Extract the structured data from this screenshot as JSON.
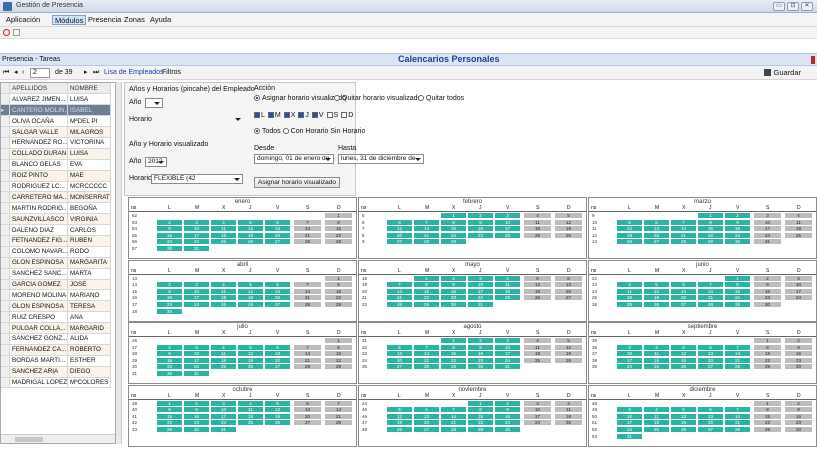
{
  "window": {
    "title": "Gestión de Presencia"
  },
  "menu": {
    "items": [
      "Aplicación",
      "Módulos",
      "Presencia",
      "Zonas",
      "Ayuda"
    ]
  },
  "panel": {
    "left_title": "Presencia - Tareas",
    "center_title": "Calencarios Personales"
  },
  "nav": {
    "position": "2",
    "of_text": "de 39",
    "list_link": "Lisa de Empleados",
    "filters": "Filtros",
    "save": "Guardar"
  },
  "grid": {
    "headers": [
      "APELLIDOS",
      "NOMBRE"
    ],
    "rows": [
      [
        "ALVAREZ JIMEN...",
        "LUISA"
      ],
      [
        "CANTERO MOLIN...",
        "ISABEL"
      ],
      [
        "OLIVA OCAÑA",
        "MªDEL PI"
      ],
      [
        "SALGAR VALLE",
        "MILAGROS"
      ],
      [
        "HERNANDEZ RO...",
        "VICTORINA"
      ],
      [
        "COLLADO DURAN",
        "LUISA"
      ],
      [
        "BLANCO GELAS",
        "EVA"
      ],
      [
        "ROIZ PINTO",
        "MAE"
      ],
      [
        "RODRIGUEZ LC...",
        "MCRCCCCC"
      ],
      [
        "CARRETERO MA...",
        "MONSERRAT"
      ],
      [
        "MARTIN RODRIG...",
        "BEGOÑA"
      ],
      [
        "SAUNZVILLASCO",
        "VIRGINIA"
      ],
      [
        "DALENO DIAZ",
        "CARLOS"
      ],
      [
        "FETNANDEZ FIG...",
        "RUBEN"
      ],
      [
        "COLOMO NAVAR...",
        "RODO"
      ],
      [
        "GLON ESPINOSA",
        "MARGARITA"
      ],
      [
        "SANCHEZ SANC...",
        "MARTA"
      ],
      [
        "GARCIA GOMEZ",
        "JOSE"
      ],
      [
        "MORENO MOLINA",
        "MARIANO"
      ],
      [
        "GLON ESPINOSA",
        "TERESA"
      ],
      [
        "RUIZ CRESPO",
        "ANA"
      ],
      [
        "PULGAR COLLA...",
        "MARGARID"
      ],
      [
        "SANCHEZ GONZ...",
        "ALIDA"
      ],
      [
        "FERNANDEZ CA...",
        "ROBERTO"
      ],
      [
        "BORDAS MARTI...",
        "ESTHER"
      ],
      [
        "SANCHEZ ARIA",
        "DIEGO"
      ],
      [
        "MADRIGAL LOPEZ",
        "MªCOLORES"
      ]
    ]
  },
  "controls": {
    "anos_label": "Años y Horarios (pincahe) del Empleado",
    "ano_label": "Año",
    "horario_label": "Horario",
    "visual_label": "Año y Horario visualizado",
    "ano_value": "2012",
    "horario_value": "FLEXIBLE (42",
    "accion_label": "Acción",
    "radio1": "Asignar horario visualizado",
    "radio2": "Quitar horario visualizado",
    "radio3": "Quitar todos",
    "days": [
      "L",
      "M",
      "X",
      "J",
      "V",
      "S",
      "D"
    ],
    "todos": "Todos",
    "con": "Con Horario",
    "sin": "Sin Horario",
    "desde_label": "Desde",
    "hasta_label": "Hasta",
    "desde_value": "domingo, 01 de enero de",
    "hasta_value": "lunes, 31 de diciembre de",
    "asignar_btn": "Asignar horario visualizado"
  },
  "calendar": {
    "header": [
      "ns",
      "L",
      "M",
      "X",
      "J",
      "V",
      "S",
      "D"
    ],
    "months": [
      {
        "name": "enero",
        "start": 6,
        "days": 31
      },
      {
        "name": "febrero",
        "start": 2,
        "days": 29
      },
      {
        "name": "marzo",
        "start": 3,
        "days": 31
      },
      {
        "name": "abril",
        "start": 6,
        "days": 30
      },
      {
        "name": "mayo",
        "start": 1,
        "days": 31
      },
      {
        "name": "junio",
        "start": 4,
        "days": 30
      },
      {
        "name": "julio",
        "start": 6,
        "days": 31
      },
      {
        "name": "agosto",
        "start": 2,
        "days": 31
      },
      {
        "name": "septiembre",
        "start": 5,
        "days": 30
      },
      {
        "name": "octubre",
        "start": 0,
        "days": 31
      },
      {
        "name": "noviembre",
        "start": 3,
        "days": 30
      },
      {
        "name": "diciembre",
        "start": 5,
        "days": 31
      }
    ]
  }
}
